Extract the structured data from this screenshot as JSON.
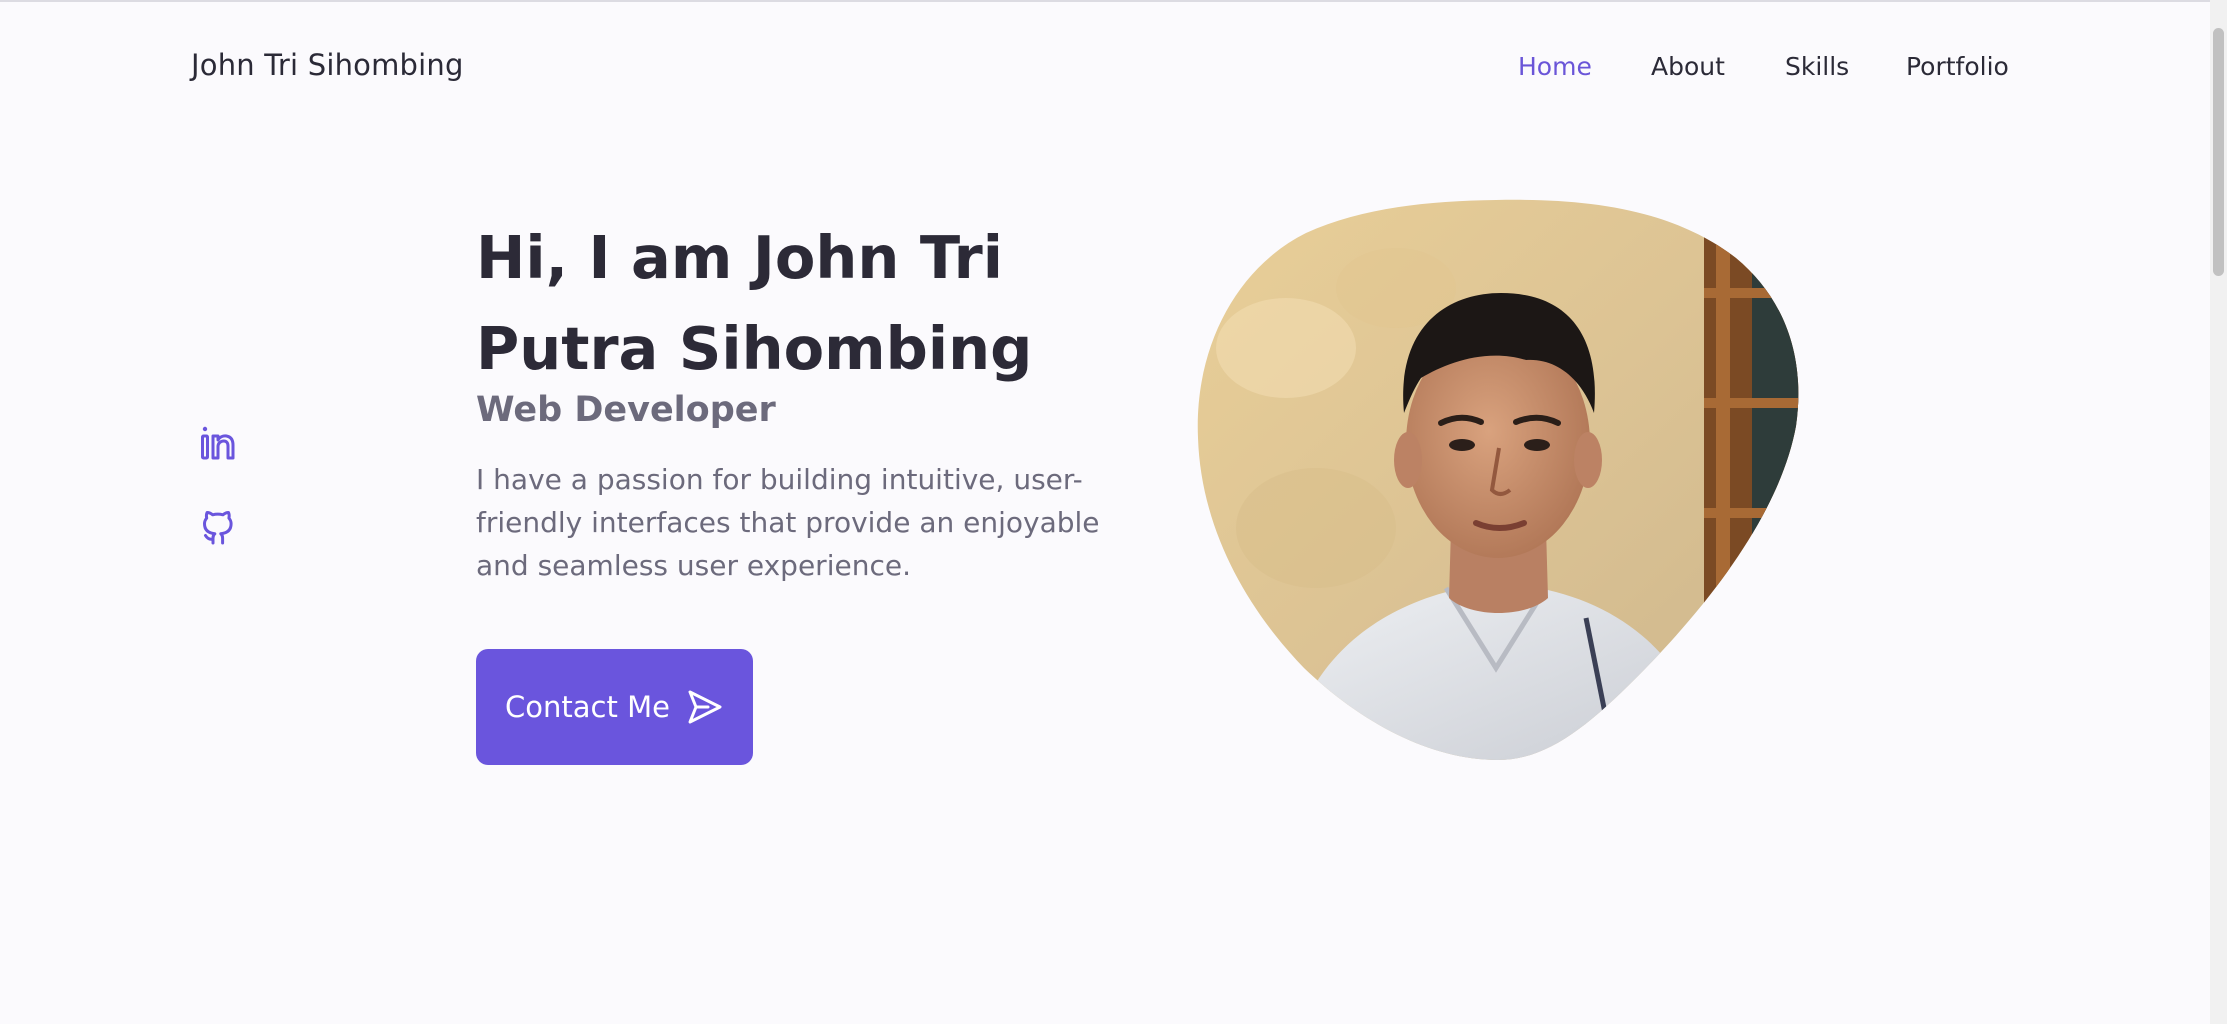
{
  "brand": {
    "name": "John Tri Sihombing"
  },
  "nav": {
    "items": [
      {
        "label": "Home",
        "active": true
      },
      {
        "label": "About",
        "active": false
      },
      {
        "label": "Skills",
        "active": false
      },
      {
        "label": "Portfolio",
        "active": false
      }
    ]
  },
  "social": {
    "icons": [
      "linkedin-icon",
      "github-icon"
    ]
  },
  "hero": {
    "title": "Hi, I am John Tri Putra Sihombing",
    "subtitle": "Web Developer",
    "description": "I have a passion for building intuitive, user-friendly interfaces that provide an enjoyable and seamless user experience.",
    "button_label": "Contact Me",
    "button_icon": "send-icon"
  },
  "theme": {
    "accent": "#6a55dd",
    "background": "#fbfafd",
    "text": "#2c2a37",
    "muted": "#6c6a7c"
  }
}
